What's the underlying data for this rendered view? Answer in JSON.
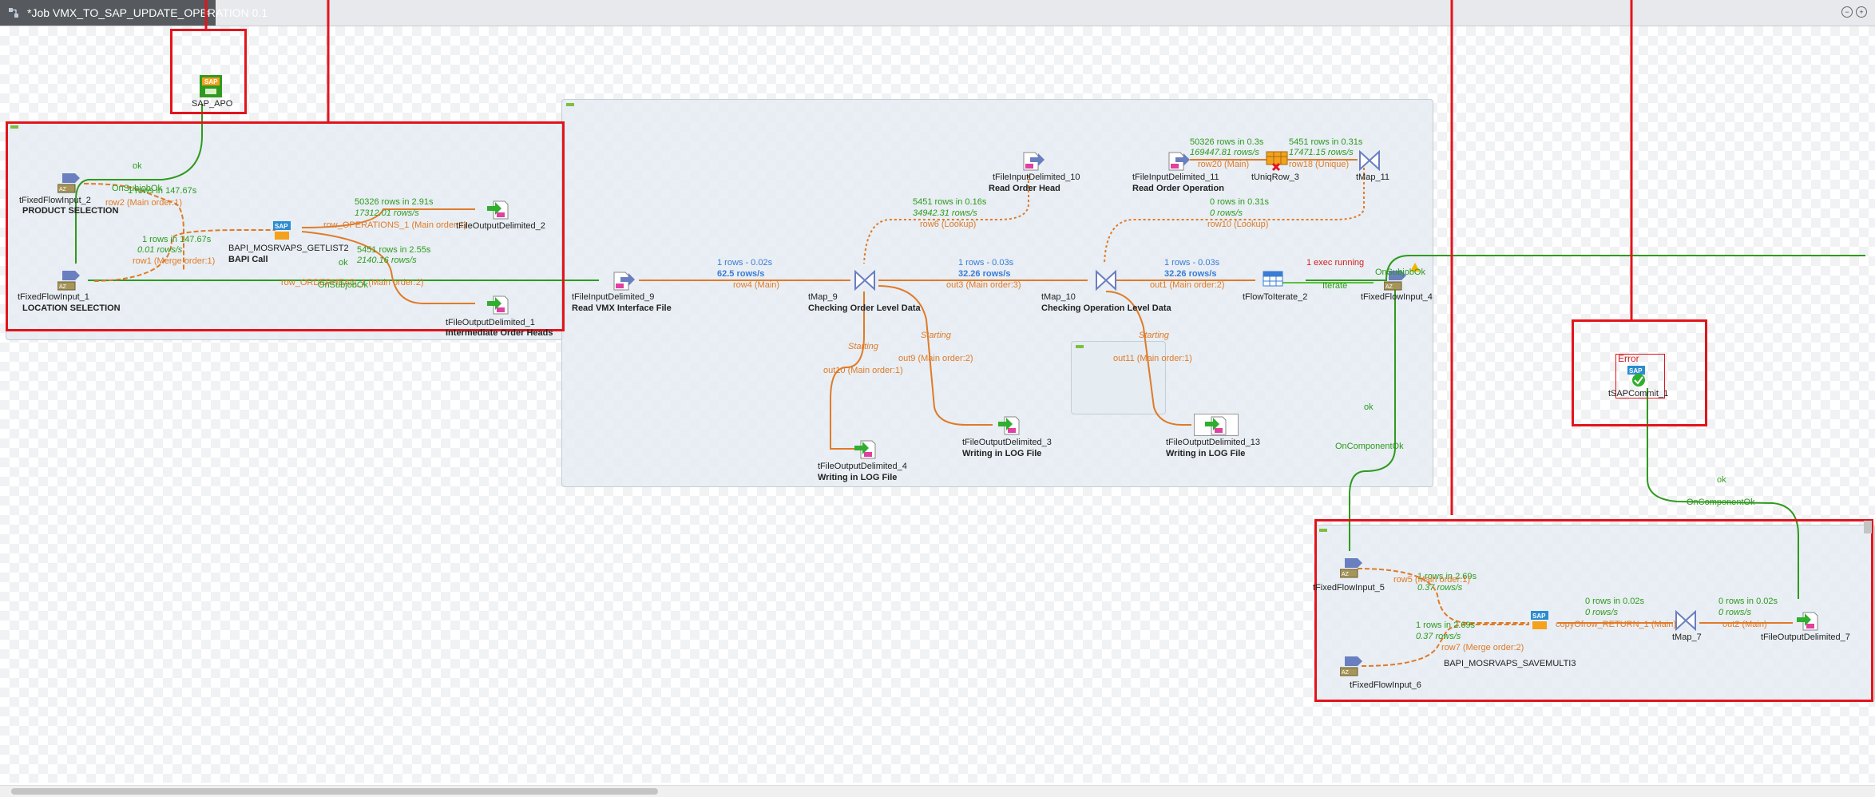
{
  "tab": {
    "title": "*Job VMX_TO_SAP_UPDATE_OPERATION 0.1",
    "close": "×"
  },
  "window_buttons": [
    "−",
    "+"
  ],
  "components": {
    "sap_apo": {
      "name": "SAP_APO"
    },
    "fixed2": {
      "name": "tFixedFlowInput_2",
      "label": "PRODUCT SELECTION"
    },
    "fixed1": {
      "name": "tFixedFlowInput_1",
      "label": "LOCATION SELECTION"
    },
    "bapi_call": {
      "name": "BAPI_MOSRVAPS_GETLIST2",
      "label": "BAPI Call"
    },
    "fod2": {
      "name": "tFileOutputDelimited_2",
      "label": ""
    },
    "fod1": {
      "name": "tFileOutputDelimited_1",
      "label": "Intermediate Order Heads"
    },
    "fid9": {
      "name": "tFileInputDelimited_9",
      "label": "Read VMX Interface File"
    },
    "fid10": {
      "name": "tFileInputDelimited_10",
      "label": "Read Order Head"
    },
    "fid11": {
      "name": "tFileInputDelimited_11",
      "label": "Read Order Operation"
    },
    "uniq3": {
      "name": "tUniqRow_3"
    },
    "map11": {
      "name": "tMap_11"
    },
    "map9": {
      "name": "tMap_9",
      "label": "Checking Order Level Data"
    },
    "map10": {
      "name": "tMap_10",
      "label": "Checking Operation Level Data"
    },
    "flowiter2": {
      "name": "tFlowToIterate_2"
    },
    "fixed4": {
      "name": "tFixedFlowInput_4"
    },
    "fod4": {
      "name": "tFileOutputDelimited_4",
      "label": "Writing in LOG  File"
    },
    "fod3": {
      "name": "tFileOutputDelimited_3",
      "label": "Writing in LOG  File"
    },
    "fod13": {
      "name": "tFileOutputDelimited_13",
      "label": "Writing in LOG  File"
    },
    "sapcommit1": {
      "name": "tSAPCommit_1",
      "error": "Error"
    },
    "fixed5": {
      "name": "tFixedFlowInput_5"
    },
    "fixed6": {
      "name": "tFixedFlowInput_6"
    },
    "bapi_save": {
      "name": "BAPI_MOSRVAPS_SAVEMULTI3"
    },
    "map7": {
      "name": "tMap_7"
    },
    "fod7": {
      "name": "tFileOutputDelimited_7"
    }
  },
  "links": {
    "ok1": "ok",
    "onsubjobok1": "OnSubjobOk",
    "row2_stats": "1 rows in 147.67s",
    "row2": "row2 (Main order:1)",
    "row1_stats": "1 rows in 147.67s",
    "row1_rate": "0.01 rows/s",
    "row1": "row1 (Merge order:1)",
    "ops_stats": "50326 rows in 2.91s",
    "ops_rate": "17312.01 rows/s",
    "ops": "row_OPERATIONS_1 (Main order:1)",
    "ordhead_stats": "5451 rows in 2.55s",
    "ordhead_rate": "2140.16 rows/s",
    "ordhead": "row_ORDERHEAD_1 (Main order:2)",
    "ok2": "ok",
    "onsubjobok2": "OnSubjobOk",
    "row4_stats": "1 rows - 0.02s",
    "row4_rate": "62.5 rows/s",
    "row4": "row4 (Main)",
    "row6_stats": "5451 rows in 0.16s",
    "row6_rate": "34942.31 rows/s",
    "row6": "row6 (Lookup)",
    "out3_stats": "1 rows - 0.03s",
    "out3_rate": "32.26 rows/s",
    "out3": "out3 (Main order:3)",
    "row20_stats": "50326 rows in 0.3s",
    "row20_rate": "169447.81 rows/s",
    "row20": "row20 (Main)",
    "row18_stats": "5451 rows in 0.31s",
    "row18_rate": "17471.15 rows/s",
    "row18": "row18 (Unique)",
    "row10_stats": "0 rows in 0.31s",
    "row10_rate": "0 rows/s",
    "row10": "row10 (Lookup)",
    "out1_stats": "1 rows - 0.03s",
    "out1_rate": "32.26 rows/s",
    "out1": "out1 (Main order:2)",
    "exec": "1 exec running",
    "iterate": "Iterate",
    "onsubjobok3": "OnSubjobOk",
    "starting1": "Starting",
    "out10": "out10 (Main order:1)",
    "starting2": "Starting",
    "out9": "out9 (Main order:2)",
    "starting3": "Starting",
    "out11": "out11 (Main order:1)",
    "ok3": "ok",
    "oncomponentok1": "OnComponentOk",
    "ok4": "ok",
    "oncomponentok2": "OnComponentOk",
    "row5_stats": "1 rows in 2.69s",
    "row5_rate": "0.37 rows/s",
    "row5": "row5 (Main order:1)",
    "row7_stats": "1 rows in 2.69s",
    "row7_rate": "0.37 rows/s",
    "row7": "row7 (Merge order:2)",
    "copy_stats": "0 rows in 0.02s",
    "copy_rate": "0 rows/s",
    "copy": "copyOfrow_RETURN_1 (Main)",
    "out2_stats": "0 rows in 0.02s",
    "out2_rate": "0 rows/s",
    "out2": "out2 (Main)"
  },
  "colors": {
    "main_link": "#e07a28",
    "trigger_link": "#2f9a1e",
    "stats_blue": "#3a7bd5",
    "highlight_red": "#e3141c"
  }
}
